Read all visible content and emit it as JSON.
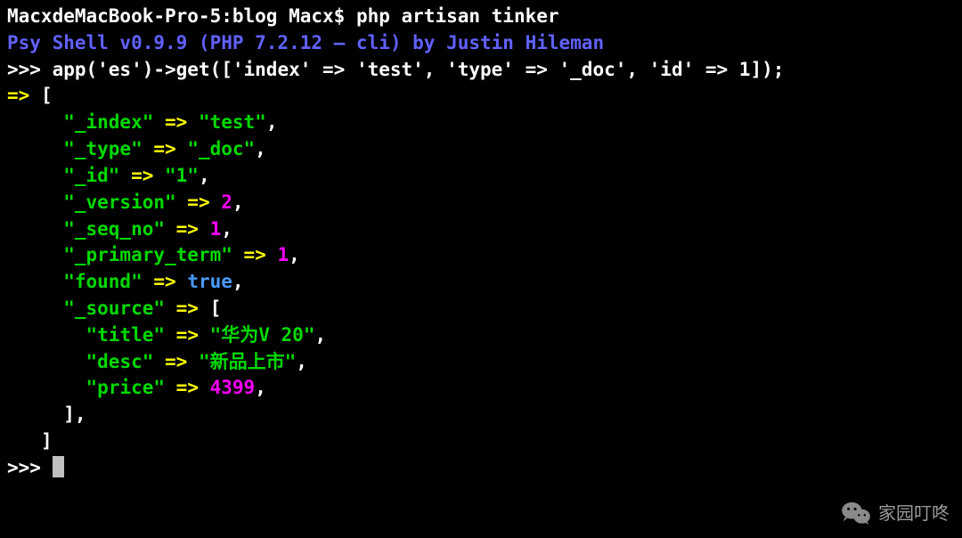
{
  "prompt_line": {
    "prompt": "MacxdeMacBook-Pro-5:blog Macx$ ",
    "command": "php artisan tinker"
  },
  "shell_banner": "Psy Shell v0.9.9 (PHP 7.2.12 — cli) by Justin Hileman",
  "repl_prompt": ">>> ",
  "repl_command": "app('es')->get(['index' => 'test', 'type' => '_doc', 'id' => 1]);",
  "arrow": "=> ",
  "open_bracket": "[",
  "close_bracket": "]",
  "response": {
    "index_key": "\"_index\"",
    "index_val": "\"test\"",
    "type_key": "\"_type\"",
    "type_val": "\"_doc\"",
    "id_key": "\"_id\"",
    "id_val": "\"1\"",
    "version_key": "\"_version\"",
    "version_val": "2",
    "seq_key": "\"_seq_no\"",
    "seq_val": "1",
    "primary_key": "\"_primary_term\"",
    "primary_val": "1",
    "found_key": "\"found\"",
    "found_val": "true",
    "source_key": "\"_source\"",
    "source_open": "[",
    "title_key": "\"title\"",
    "title_val": "\"华为V 20\"",
    "desc_key": "\"desc\"",
    "desc_val": "\"新品上市\"",
    "price_key": "\"price\"",
    "price_val": "4399",
    "source_close": "],"
  },
  "final_prompt": ">>> ",
  "kv_arrow": " => ",
  "comma": ",",
  "watermark": "家园叮咚"
}
